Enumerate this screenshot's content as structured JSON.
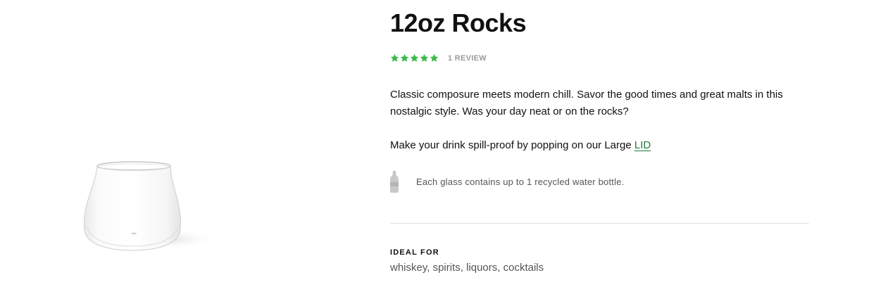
{
  "product": {
    "title": "12oz Rocks",
    "rating": {
      "stars": 5,
      "max": 5,
      "review_text": "1 REVIEW"
    },
    "description": "Classic composure meets modern chill. Savor the good times and great malts in this nostalgic style. Was your day neat or on the rocks?",
    "lid_text": "Make your drink spill-proof by popping on our Large ",
    "lid_link": "LID",
    "recycle_text": "Each glass contains up to 1 recycled water bottle.",
    "ideal_for_label": "IDEAL FOR",
    "ideal_for_value": "whiskey, spirits, liquors, cocktails"
  },
  "colors": {
    "star": "#3cb84c",
    "link": "#1d7a3a",
    "muted": "#9a9a9a"
  },
  "icons": [
    "star-icon",
    "water-bottle-icon"
  ]
}
